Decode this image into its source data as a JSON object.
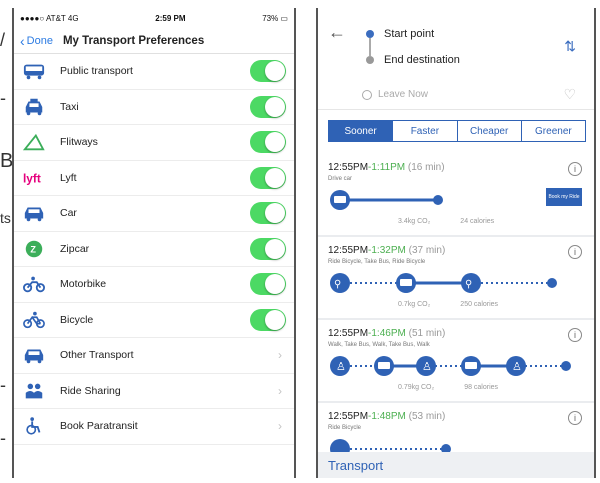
{
  "left": {
    "status": {
      "carrier": "●●●●○ AT&T 4G",
      "time": "2:59 PM",
      "battery": "73%"
    },
    "nav": {
      "back_label": "Done",
      "title": "My Transport Preferences"
    },
    "rows": [
      {
        "label": "Public transport",
        "icon": "bus-icon",
        "toggle": true
      },
      {
        "label": "Taxi",
        "icon": "taxi-icon",
        "toggle": true
      },
      {
        "label": "Flitways",
        "icon": "flitways-icon",
        "toggle": true
      },
      {
        "label": "Lyft",
        "icon": "lyft-icon",
        "toggle": true
      },
      {
        "label": "Car",
        "icon": "car-icon",
        "toggle": true
      },
      {
        "label": "Zipcar",
        "icon": "zipcar-icon",
        "toggle": true
      },
      {
        "label": "Motorbike",
        "icon": "motorbike-icon",
        "toggle": true
      },
      {
        "label": "Bicycle",
        "icon": "bicycle-icon",
        "toggle": true
      },
      {
        "label": "Other Transport",
        "icon": "car-icon",
        "toggle": false
      },
      {
        "label": "Ride Sharing",
        "icon": "people-icon",
        "toggle": false
      },
      {
        "label": "Book Paratransit",
        "icon": "wheelchair-icon",
        "toggle": false
      }
    ]
  },
  "right": {
    "start_point": "Start point",
    "end_destination": "End destination",
    "leave_now": "Leave Now",
    "tabs": [
      "Sooner",
      "Faster",
      "Cheaper",
      "Greener"
    ],
    "active_tab": "Sooner",
    "routes": [
      {
        "depart": "12:55PM",
        "arrive": "-1:11PM",
        "duration": "(16 min)",
        "modes": "Drive car",
        "stats": [
          "3.4kg CO₂",
          "24 calories"
        ],
        "book_label": "Book my Ride"
      },
      {
        "depart": "12:55PM",
        "arrive": "-1:32PM",
        "duration": "(37 min)",
        "modes": "Ride Bicycle, Take Bus, Ride Bicycle",
        "stats": [
          "0.7kg CO₂",
          "250 calories"
        ]
      },
      {
        "depart": "12:55PM",
        "arrive": "-1:46PM",
        "duration": "(51 min)",
        "modes": "Walk, Take Bus, Walk, Take Bus, Walk",
        "stats": [
          "0.79kg CO₂",
          "98 calories"
        ]
      },
      {
        "depart": "12:55PM",
        "arrive": "-1:48PM",
        "duration": "(53 min)",
        "modes": "Ride Bicycle",
        "stats": []
      }
    ],
    "bottom_title": "Transport"
  },
  "colors": {
    "ios_green": "#4cd964",
    "brand_blue": "#2f62b5",
    "arrival_green": "#4caf50"
  }
}
